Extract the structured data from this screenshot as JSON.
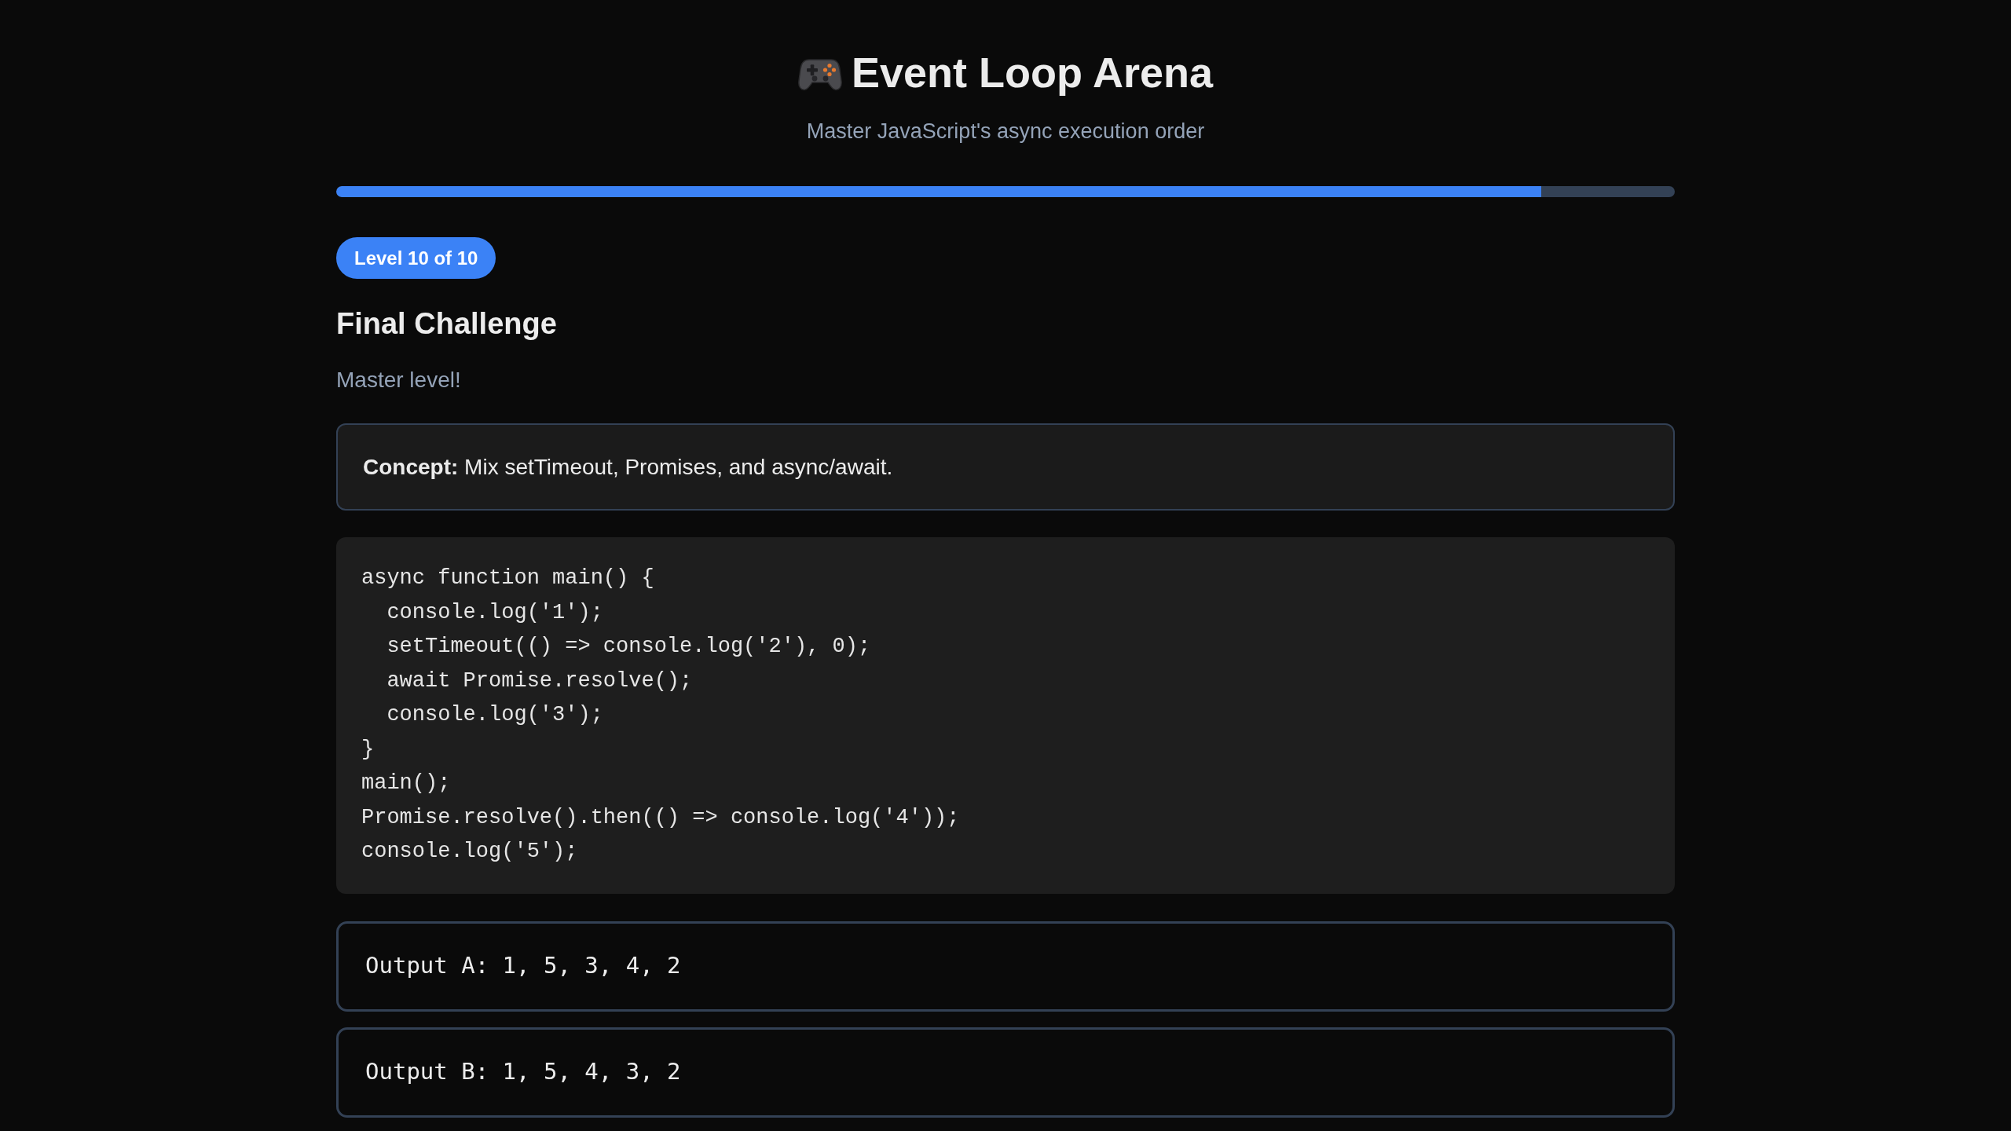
{
  "header": {
    "title": "Event Loop Arena",
    "subtitle": "Master JavaScript's async execution order"
  },
  "progress": {
    "level": 0.9
  },
  "level_badge": "Level 10 of 10",
  "challenge": {
    "title": "Final Challenge",
    "description": "Master level!",
    "concept": "**Concept:** Mix setTimeout, Promises, and async/await.",
    "code": [
      "async function main() {",
      "  console.log('1');",
      "  setTimeout(() => console.log('2'), 0);",
      "  await Promise.resolve();",
      "  console.log('3');",
      "}",
      "main();",
      "Promise.resolve().then(() => console.log('4'));",
      "console.log('5');"
    ]
  },
  "options": [
    {
      "label": "Output A: 1, 5, 3, 4, 2",
      "selected": false
    },
    {
      "label": "Output B: 1, 5, 4, 3, 2",
      "selected": false
    }
  ]
}
